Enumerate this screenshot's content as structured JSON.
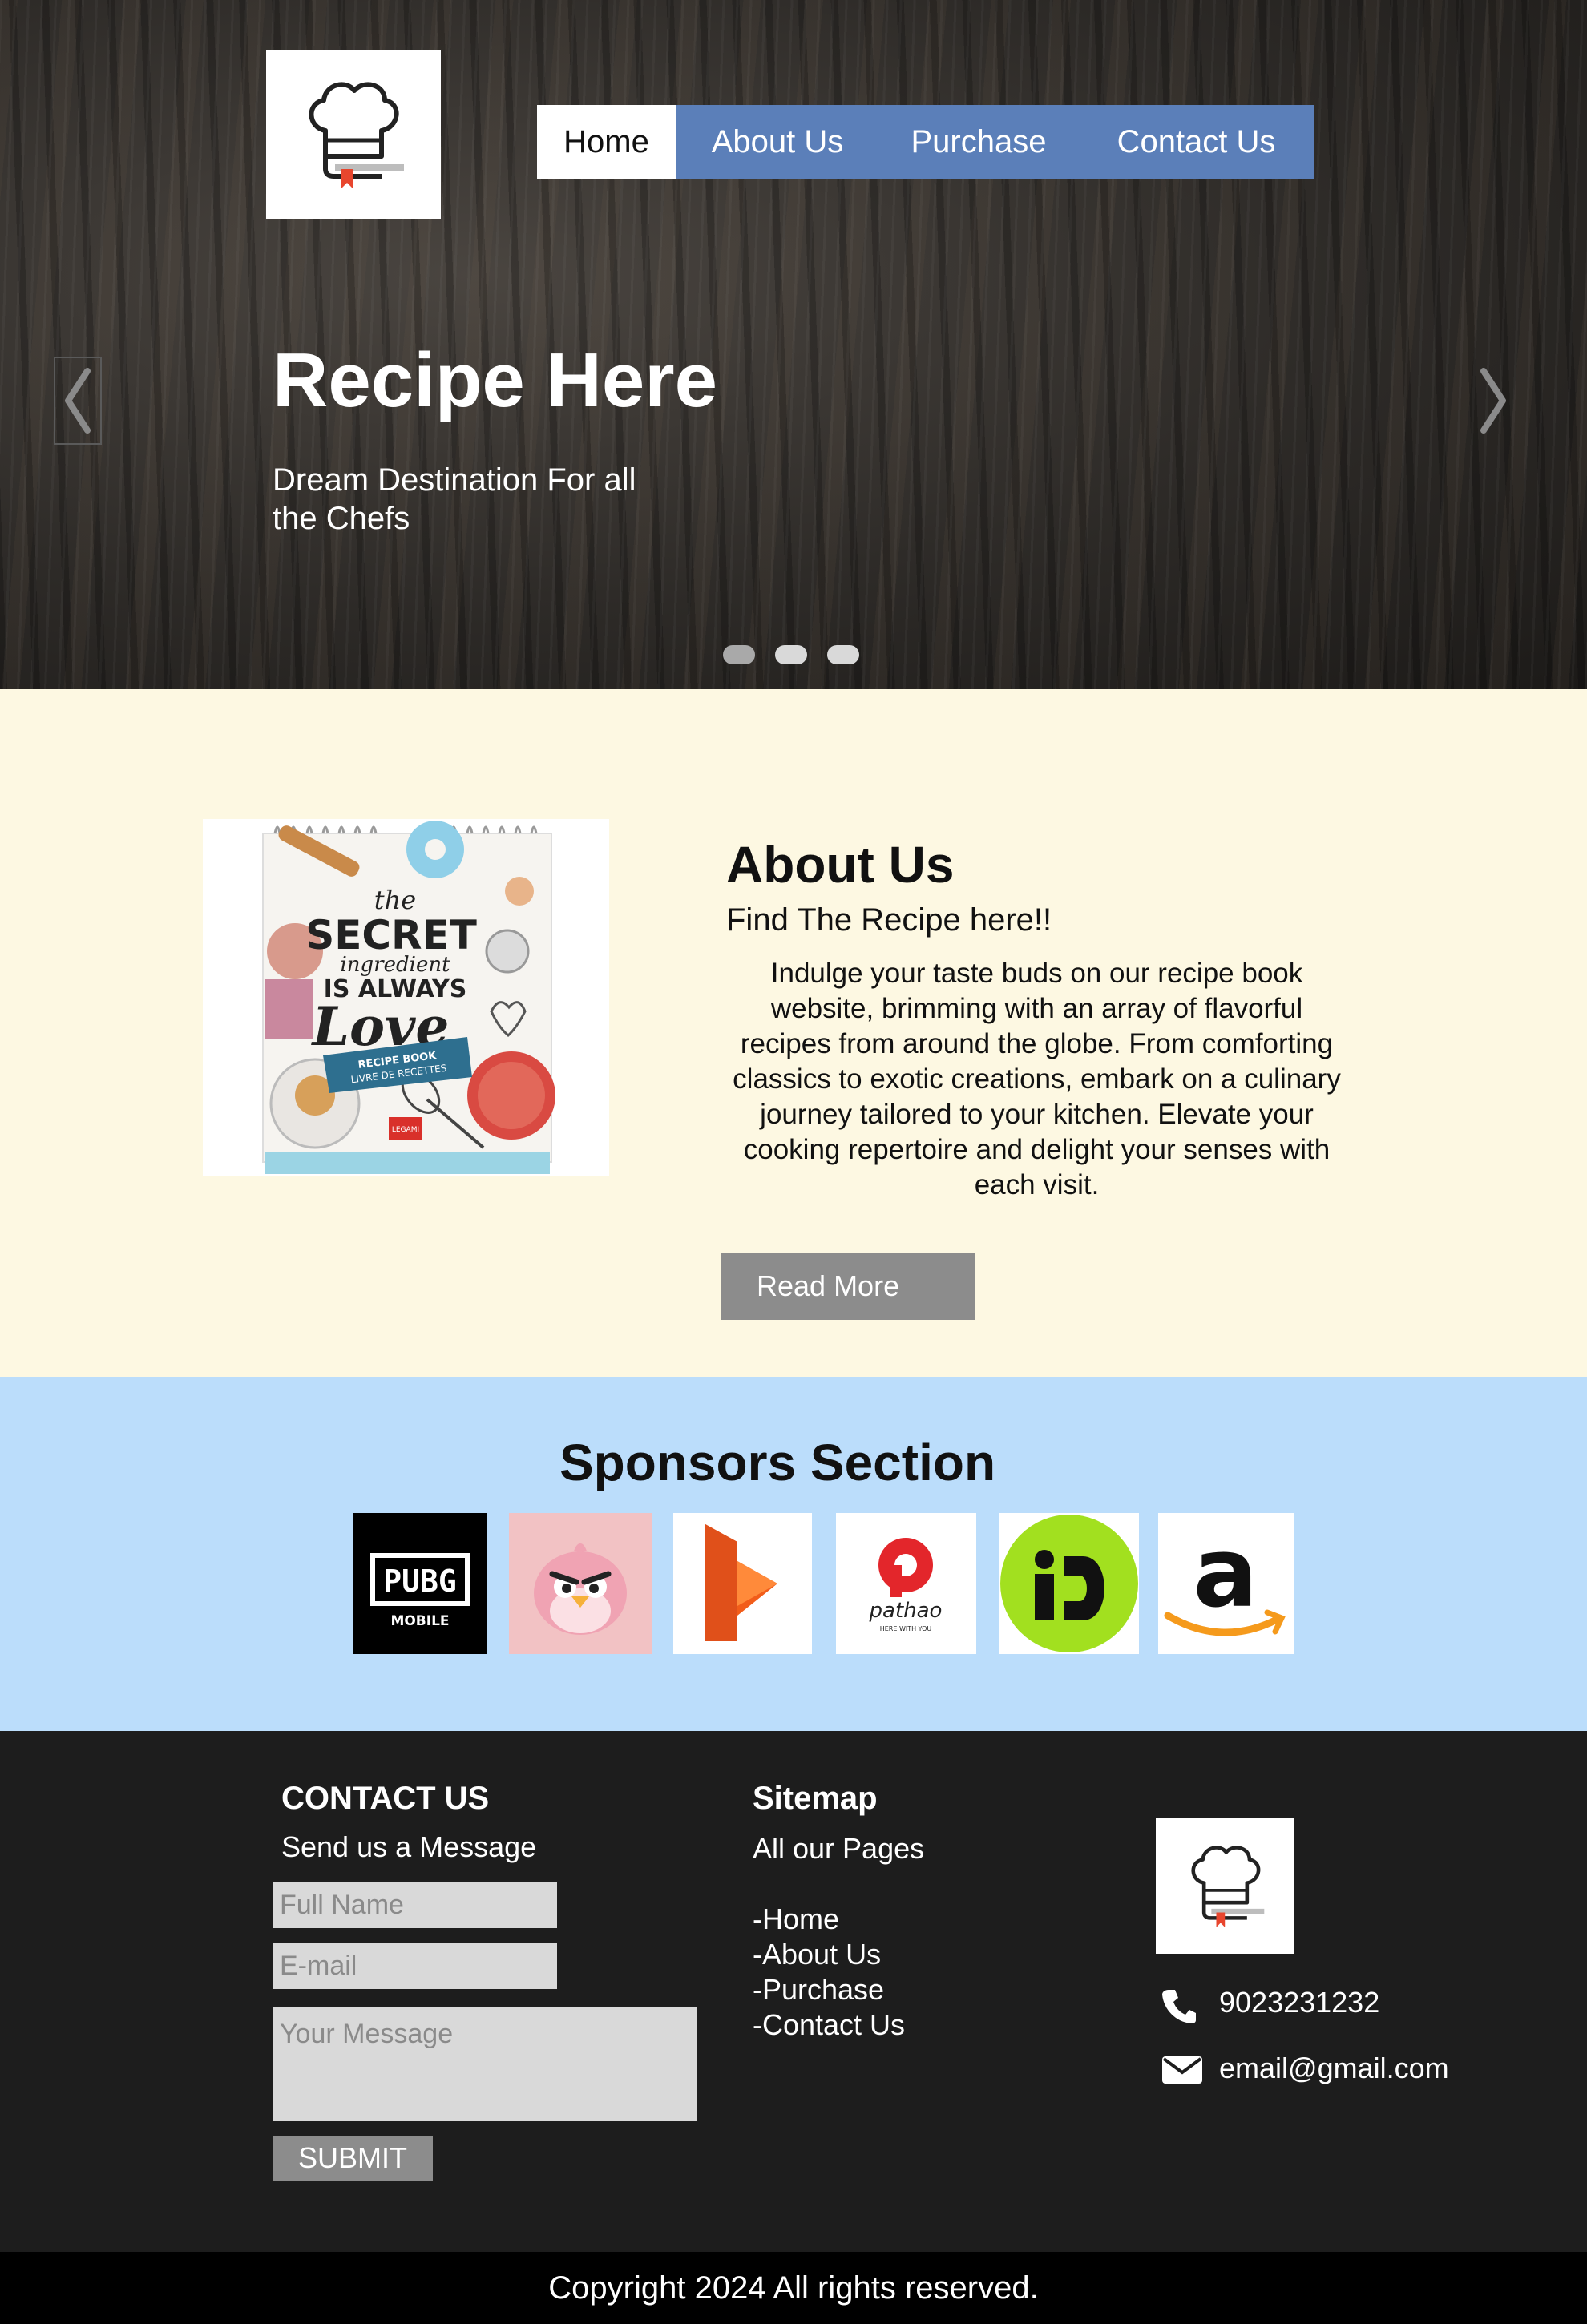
{
  "nav": {
    "items": [
      {
        "label": "Home"
      },
      {
        "label": "About Us"
      },
      {
        "label": "Purchase"
      },
      {
        "label": "Contact Us"
      }
    ],
    "active": "Home"
  },
  "hero": {
    "title": "Recipe Here",
    "subtitle": "Dream Destination For all the Chefs",
    "slides_total": 3,
    "slide_active": 1
  },
  "about": {
    "title": "About Us",
    "subtitle": "Find The Recipe here!!",
    "body": "Indulge your taste buds on our recipe book website, brimming with an array of flavorful recipes from around the globe. From comforting classics to exotic creations, embark on a culinary journey tailored to your kitchen. Elevate your cooking repertoire and delight your senses with each visit.",
    "button": "Read More",
    "book": {
      "line1": "the",
      "line2": "SECRET",
      "line3": "ingredient",
      "line4": "IS ALWAYS",
      "line5": "Love",
      "ribbon1": "RECIPE BOOK",
      "ribbon2": "LIVRE DE RECETTES",
      "brand": "LEGAMI"
    }
  },
  "sponsors": {
    "title": "Sponsors Section",
    "logos": [
      {
        "name": "pubg-mobile",
        "text1": "PUBG",
        "text2": "MOBILE"
      },
      {
        "name": "angry-bird"
      },
      {
        "name": "daraz"
      },
      {
        "name": "pathao",
        "text1": "pathao",
        "text2": "HERE WITH YOU"
      },
      {
        "name": "indrive"
      },
      {
        "name": "amazon",
        "text1": "a"
      }
    ]
  },
  "footer": {
    "contact": {
      "heading": "CONTACT US",
      "subheading": "Send us a Message",
      "name_placeholder": "Full Name",
      "email_placeholder": "E-mail",
      "message_placeholder": "Your Message",
      "submit": "SUBMIT"
    },
    "sitemap": {
      "heading": "Sitemap",
      "subheading": "All our Pages",
      "links": [
        "-Home",
        "-About Us",
        "-Purchase",
        "-Contact Us"
      ]
    },
    "info": {
      "phone": "9023231232",
      "email": "email@gmail.com"
    },
    "copyright": "Copyright 2024 All rights reserved."
  },
  "colors": {
    "nav": "#5b7fb9",
    "about_bg": "#fdf8e2",
    "sponsors_bg": "#bbddfb",
    "footer_bg": "#1d1d1d",
    "button_gray": "#8c8c8c"
  }
}
